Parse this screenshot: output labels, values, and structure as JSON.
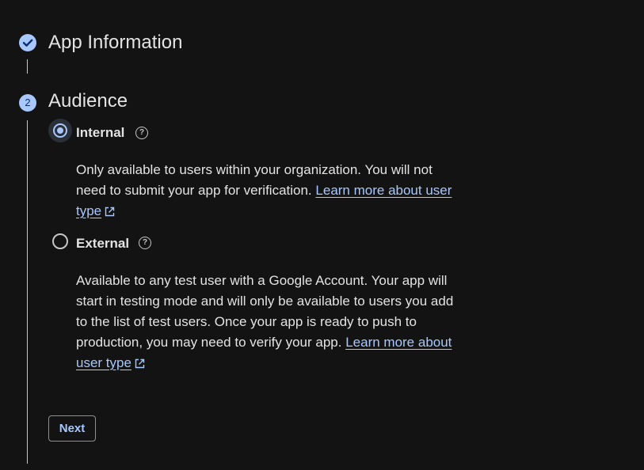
{
  "steps": [
    {
      "title": "App Information",
      "status": "completed",
      "icon": "check-icon"
    },
    {
      "title": "Audience",
      "number": "2",
      "status": "active"
    }
  ],
  "audience": {
    "options": [
      {
        "label": "Internal",
        "selected": true,
        "description": "Only available to users within your organization. You will not need to submit your app for verification.",
        "link_text": "Learn more about user type"
      },
      {
        "label": "External",
        "selected": false,
        "description": "Available to any test user with a Google Account. Your app will start in testing mode and will only be available to users you add to the list of test users. Once your app is ready to push to production, you may need to verify your app.",
        "link_text": "Learn more about user type"
      }
    ],
    "help_icon": "help-circle-icon",
    "link_icon": "open-in-new-icon"
  },
  "actions": {
    "next_label": "Next"
  },
  "colors": {
    "background": "#131314",
    "accent": "#a8c7fa",
    "text": "#e3e3e3"
  }
}
